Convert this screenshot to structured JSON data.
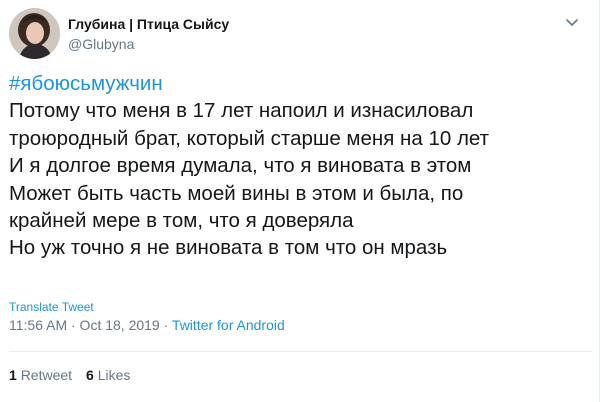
{
  "author": {
    "display_name": "Глубина | Птица Сыйсу",
    "handle": "@Glubyna"
  },
  "icons": {
    "avatar": "avatar-photo",
    "more": "chevron-down-icon"
  },
  "tweet": {
    "hashtag": "#ябоюсьмужчин",
    "lines": [
      "Потому что меня в 17 лет напоил и изнасиловал",
      "троюродный брат, который старше меня на 10 лет",
      "И я долгое время думала, что я виновата в этом",
      "Может быть часть моей вины в этом и была, по",
      "крайней мере в том, что я доверяла",
      "Но уж точно я не виновата в том что он мразь"
    ],
    "translate_label": "Translate Tweet",
    "timestamp": "11:56 AM · Oct 18, 2019",
    "separator": " · ",
    "source": "Twitter for Android"
  },
  "stats": {
    "retweets_count": "1",
    "retweets_label": "Retweet",
    "likes_count": "6",
    "likes_label": "Likes"
  },
  "colors": {
    "link": "#1b95e0",
    "text": "#14171a",
    "secondary": "#657786",
    "divider": "#e6ecf0"
  }
}
